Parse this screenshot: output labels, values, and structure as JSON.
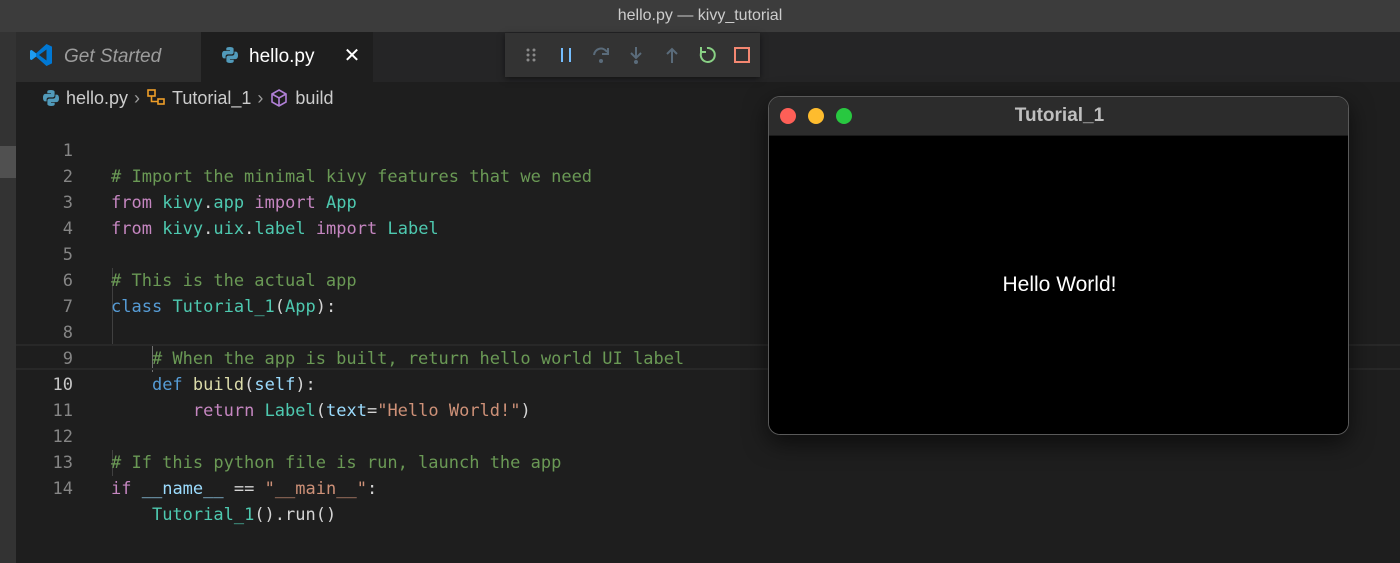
{
  "window": {
    "title": "hello.py — kivy_tutorial"
  },
  "tabs": [
    {
      "label": "Get Started",
      "icon": "vscode-logo-icon"
    },
    {
      "label": "hello.py",
      "icon": "python-icon",
      "close": "✕"
    }
  ],
  "debug_toolbar": {
    "actions": [
      "drag-handle",
      "pause",
      "step-over",
      "step-into",
      "step-out",
      "restart",
      "stop"
    ],
    "colors": {
      "pause": "#75beff",
      "disabled": "#5a6b7a",
      "restart": "#89d185",
      "stop": "#f48771"
    }
  },
  "breadcrumb": {
    "file": "hello.py",
    "class": "Tutorial_1",
    "method": "build"
  },
  "editor": {
    "current_line": 10,
    "line_numbers": [
      "1",
      "2",
      "3",
      "4",
      "5",
      "6",
      "7",
      "8",
      "9",
      "10",
      "11",
      "12",
      "13",
      "14"
    ],
    "lines": {
      "l1": {
        "comment": "# Import the minimal kivy features that we need"
      },
      "l2": {
        "from": "from",
        "module": "kivy",
        "dot": ".",
        "sub": "app",
        "import": "import",
        "name": "App"
      },
      "l3": {
        "from": "from",
        "module": "kivy",
        "dot1": ".",
        "sub1": "uix",
        "dot2": ".",
        "sub2": "label",
        "import": "import",
        "name": "Label"
      },
      "l5": {
        "comment": "# This is the actual app"
      },
      "l6": {
        "class": "class",
        "name": "Tutorial_1",
        "open": "(",
        "base": "App",
        "close": "):"
      },
      "l8": {
        "comment": "# When the app is built, return hello world UI label"
      },
      "l9": {
        "def": "def",
        "name": "build",
        "open": "(",
        "param": "self",
        "close": "):"
      },
      "l10": {
        "return": "return",
        "call": "Label",
        "open": "(",
        "kwarg": "text",
        "eq": "=",
        "str": "\"Hello World!\"",
        "close": ")"
      },
      "l12": {
        "comment": "# If this python file is run, launch the app"
      },
      "l13": {
        "if": "if",
        "var": "__name__",
        "op": " == ",
        "str": "\"__main__\"",
        "colon": ":"
      },
      "l14": {
        "cls": "Tutorial_1",
        "rest": "().run()"
      }
    }
  },
  "kivy_window": {
    "title": "Tutorial_1",
    "label": "Hello World!"
  }
}
